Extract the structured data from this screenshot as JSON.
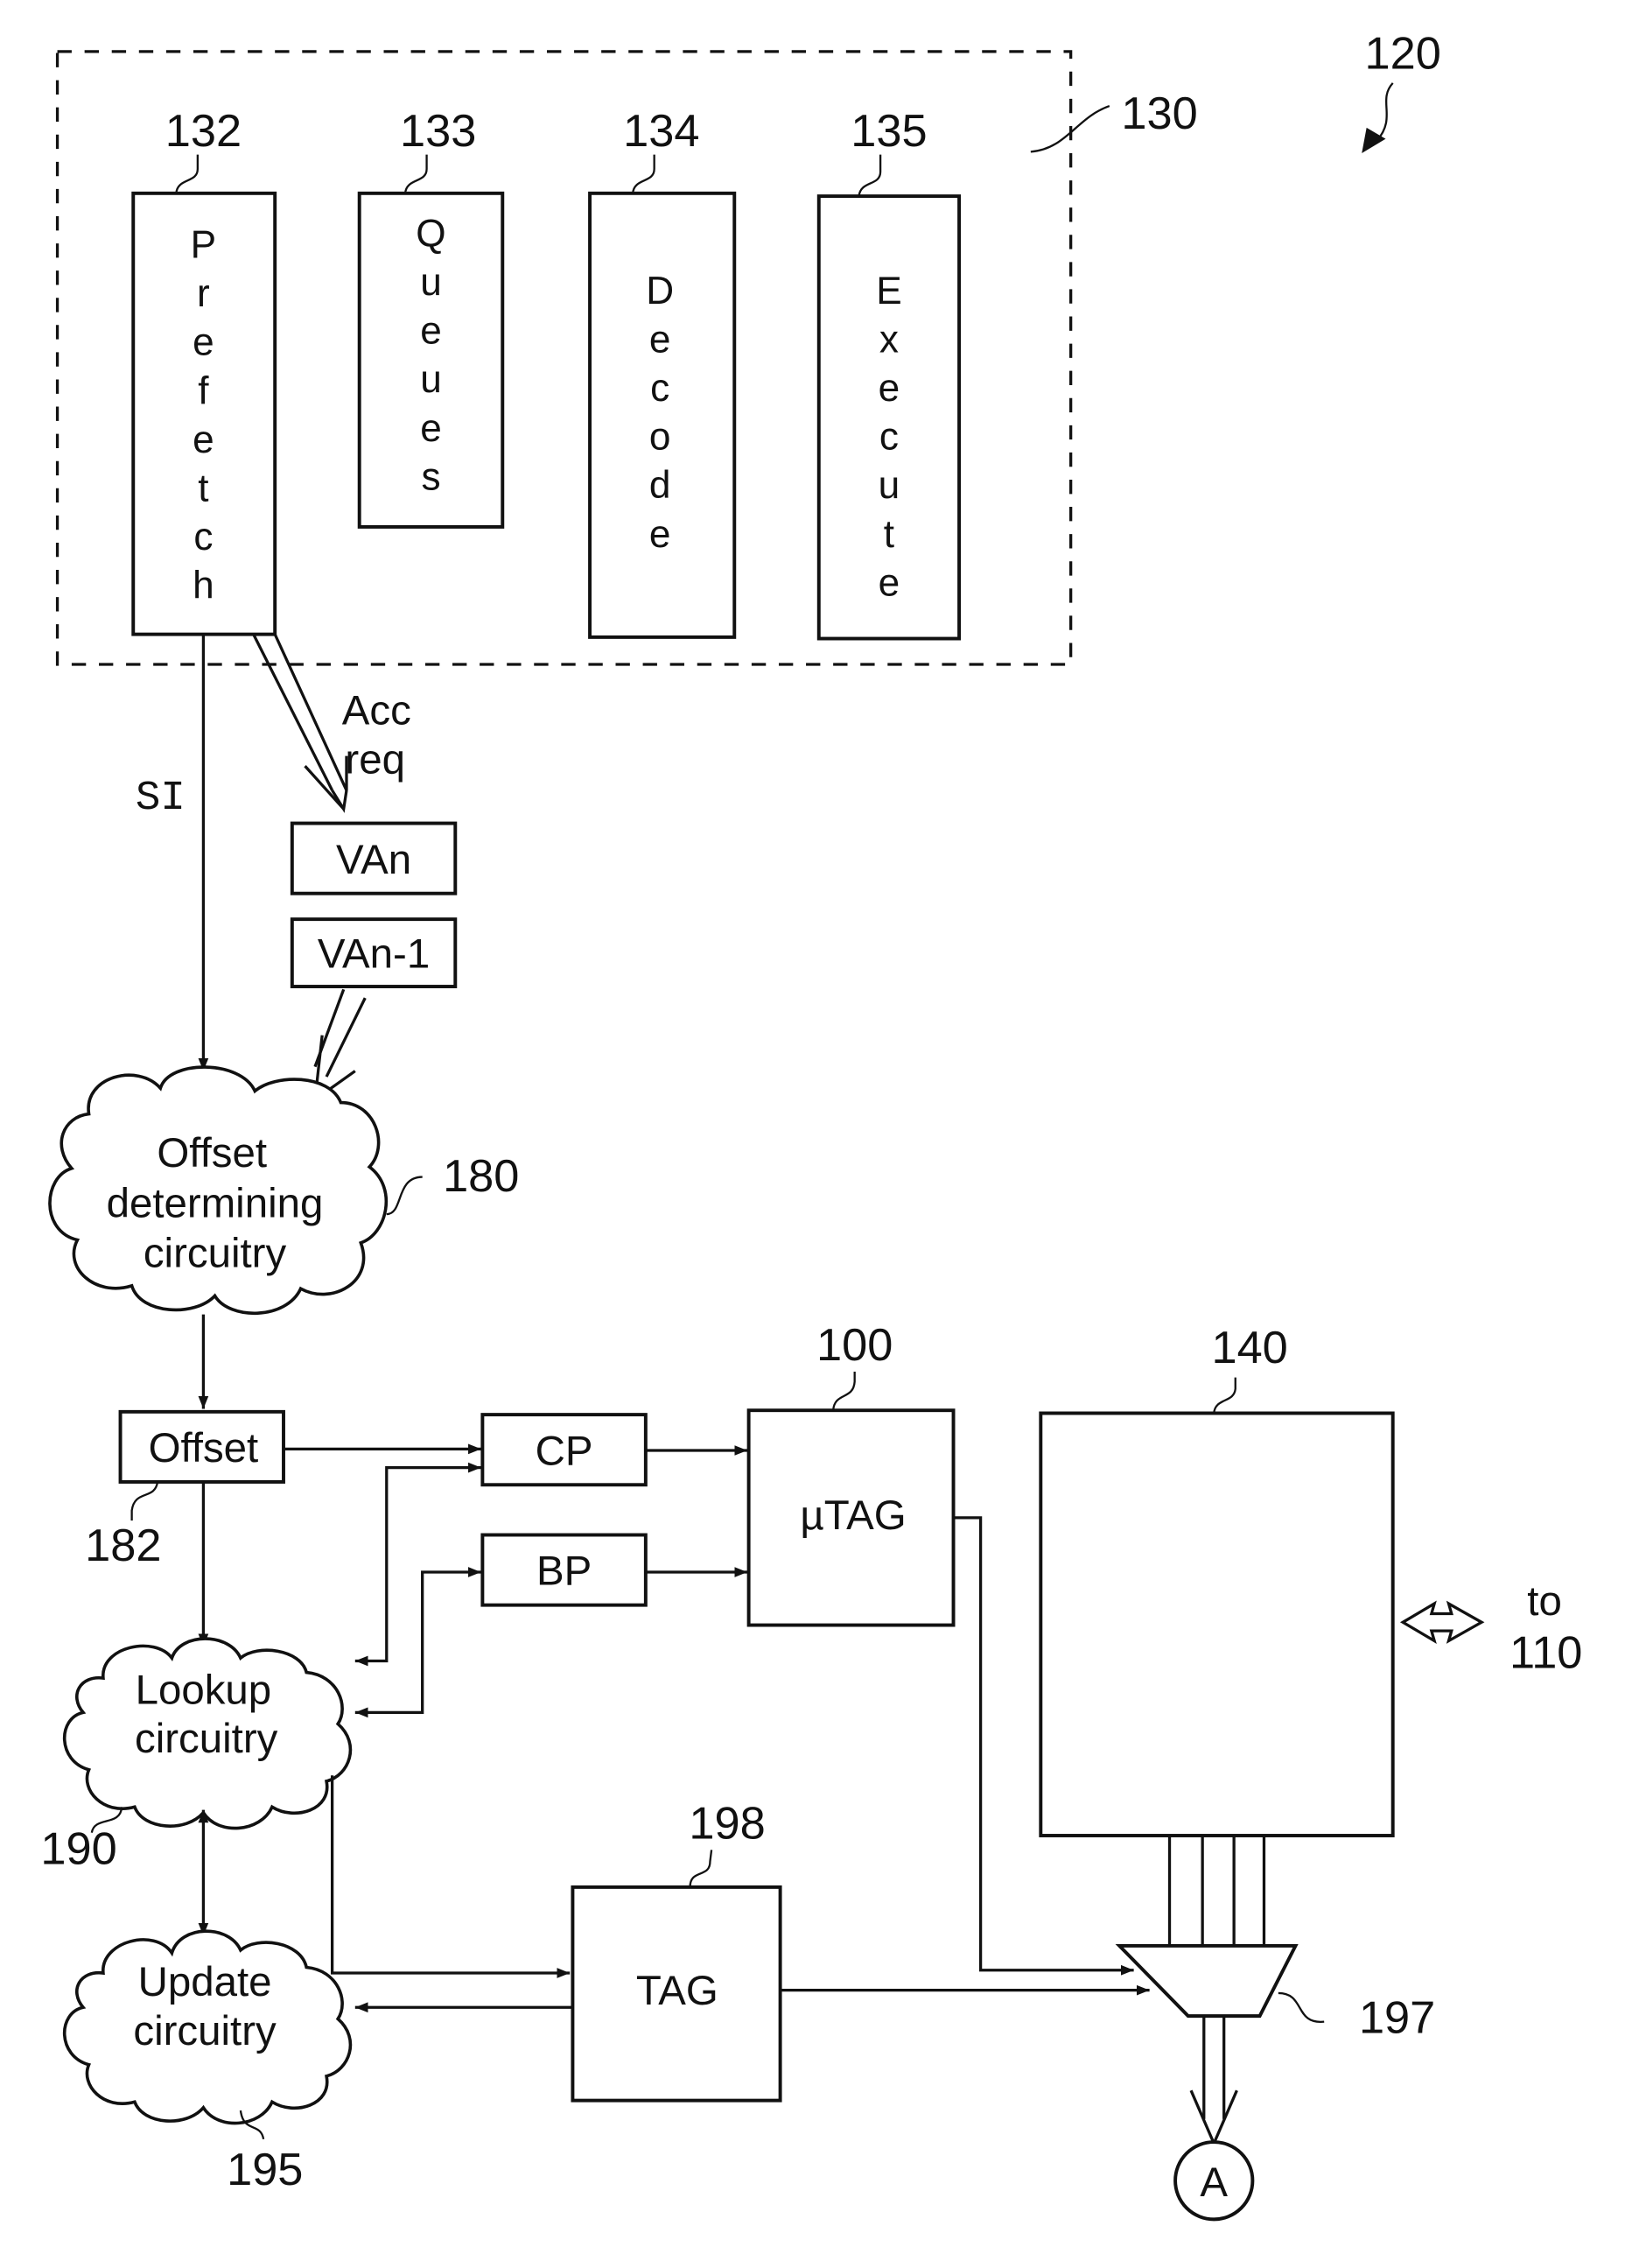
{
  "figure": {
    "reference": "120",
    "pipeline": {
      "reference": "130",
      "stages": [
        {
          "ref": "132",
          "label": "Prefetch"
        },
        {
          "ref": "133",
          "label": "Queues"
        },
        {
          "ref": "134",
          "label": "Decode"
        },
        {
          "ref": "135",
          "label": "Execute"
        }
      ]
    },
    "signals": {
      "si": "SI",
      "acc_req_line1": "Acc",
      "acc_req_line2": "req"
    },
    "registers": {
      "van": "VAn",
      "van_1": "VAn-1"
    },
    "offset_circuit": {
      "ref": "180",
      "line1": "Offset",
      "line2": "determining",
      "line3": "circuitry"
    },
    "offset_box": {
      "ref": "182",
      "label": "Offset"
    },
    "cp_box": {
      "label": "CP"
    },
    "bp_box": {
      "label": "BP"
    },
    "utag_box": {
      "ref": "100",
      "label": "µTAG"
    },
    "cache_box": {
      "ref": "140"
    },
    "external": {
      "line1": "to",
      "line2": "110"
    },
    "lookup_circuit": {
      "ref": "190",
      "line1": "Lookup",
      "line2": "circuitry"
    },
    "update_circuit": {
      "ref": "195",
      "line1": "Update",
      "line2": "circuitry"
    },
    "tag_box": {
      "ref": "198",
      "label": "TAG"
    },
    "mux": {
      "ref": "197"
    },
    "connector": {
      "label": "A"
    }
  }
}
